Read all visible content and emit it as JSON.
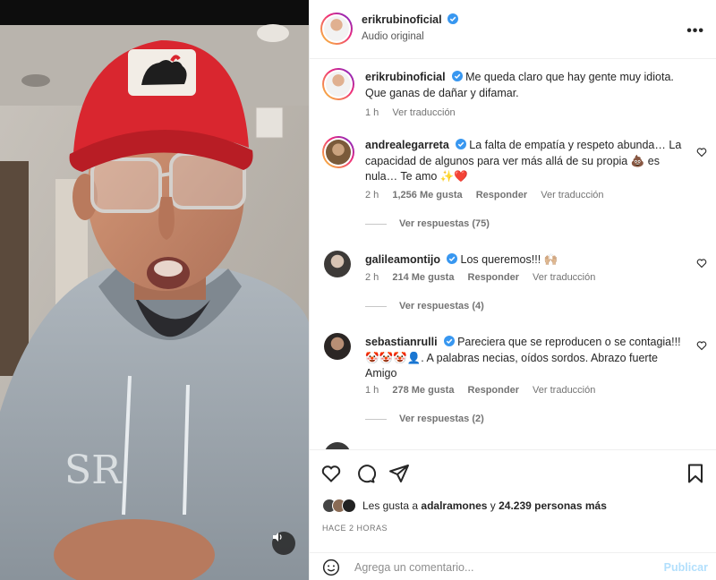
{
  "header": {
    "username": "erikrubinoficial",
    "audio": "Audio original",
    "more_icon": "more-icon"
  },
  "comments": [
    {
      "username": "erikrubinoficial",
      "text": "Me queda claro que hay gente muy idiota. Que ganas de dañar y difamar.",
      "time": "1 h",
      "likes": "",
      "reply": "",
      "translate": "Ver traducción",
      "replies": ""
    },
    {
      "username": "andrealegarreta",
      "text": "La falta de empatía y respeto abunda… La capacidad de algunos para ver más allá de su propia 💩 es nula… Te amo ✨❤️",
      "time": "2 h",
      "likes": "1,256 Me gusta",
      "reply": "Responder",
      "translate": "Ver traducción",
      "replies": "Ver respuestas (75)"
    },
    {
      "username": "galileamontijo",
      "text": "Los queremos!!! 🙌🏼",
      "time": "2 h",
      "likes": "214 Me gusta",
      "reply": "Responder",
      "translate": "Ver traducción",
      "replies": "Ver respuestas (4)"
    },
    {
      "username": "sebastianrulli",
      "text": "Pareciera que se reproducen o se contagia!!! 🤡🤡🤡👤. A palabras necias, oídos sordos. Abrazo fuerte Amigo",
      "time": "1 h",
      "likes": "278 Me gusta",
      "reply": "Responder",
      "translate": "Ver traducción",
      "replies": "Ver respuestas (2)"
    }
  ],
  "likes_summary": {
    "prefix": "Les gusta a",
    "user": "adalramones",
    "connector": "y",
    "count": "24.239 personas más"
  },
  "time_ago": "HACE 2 HORAS",
  "composer": {
    "placeholder": "Agrega un comentario...",
    "post_label": "Publicar"
  },
  "colors": {
    "verified": "#3897f0",
    "hat_red": "#d9262f",
    "hoodie": "#9aa3ab",
    "publish_disabled": "#b2dffc"
  }
}
